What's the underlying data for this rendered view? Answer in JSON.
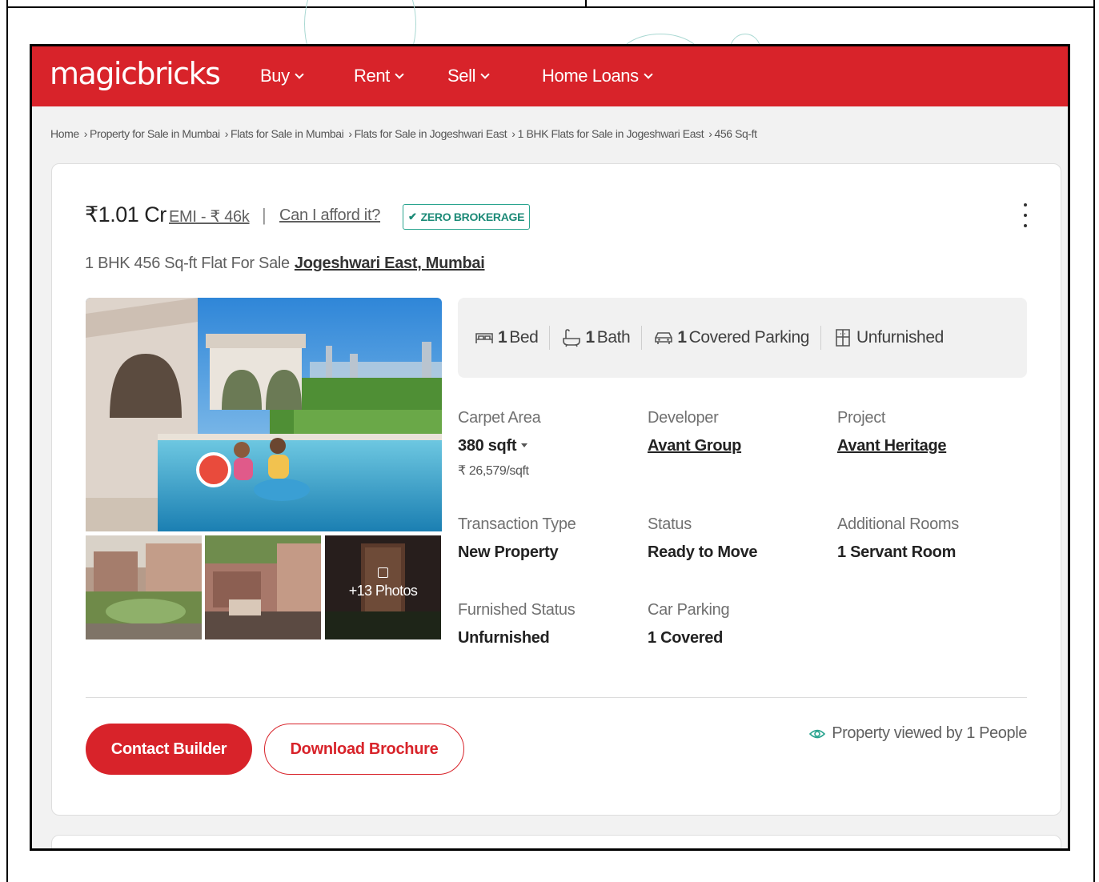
{
  "header": {
    "logo": "magicbricks",
    "nav": [
      "Buy",
      "Rent",
      "Sell",
      "Home Loans"
    ]
  },
  "breadcrumb": [
    "Home",
    "Property for Sale in Mumbai",
    "Flats for Sale in Mumbai",
    "Flats for Sale in Jogeshwari East",
    "1 BHK Flats for Sale in Jogeshwari East",
    "456 Sq-ft"
  ],
  "listing": {
    "price": "₹1.01 Cr",
    "emi": "EMI - ₹ 46k",
    "pipe": "|",
    "afford": "Can I afford it?",
    "badge": "ZERO BROKERAGE",
    "title": "1 BHK 456 Sq-ft Flat For Sale",
    "location": "Jogeshwari East, Mumbai",
    "photos_label": "+13 Photos"
  },
  "amenities": [
    {
      "num": "1",
      "text": "Bed",
      "icon": "bed-icon"
    },
    {
      "num": "1",
      "text": "Bath",
      "icon": "bath-icon"
    },
    {
      "num": "1",
      "text": "Covered Parking",
      "icon": "car-icon"
    },
    {
      "num": "",
      "text": "Unfurnished",
      "icon": "furniture-icon"
    }
  ],
  "specs": {
    "carpet_area": {
      "label": "Carpet Area",
      "value": "380 sqft",
      "sub": "₹ 26,579/sqft"
    },
    "developer": {
      "label": "Developer",
      "value": "Avant Group"
    },
    "project": {
      "label": "Project",
      "value": "Avant Heritage"
    },
    "transaction": {
      "label": "Transaction Type",
      "value": "New Property"
    },
    "status": {
      "label": "Status",
      "value": "Ready to Move"
    },
    "additional_rooms": {
      "label": "Additional Rooms",
      "value": "1 Servant Room"
    },
    "furnished": {
      "label": "Furnished Status",
      "value": "Unfurnished"
    },
    "car_parking": {
      "label": "Car Parking",
      "value": "1 Covered"
    }
  },
  "actions": {
    "contact": "Contact Builder",
    "brochure": "Download Brochure",
    "viewed": "Property viewed by 1 People"
  },
  "colors": {
    "brand": "#d8232a",
    "badge": "#1c8a77"
  }
}
